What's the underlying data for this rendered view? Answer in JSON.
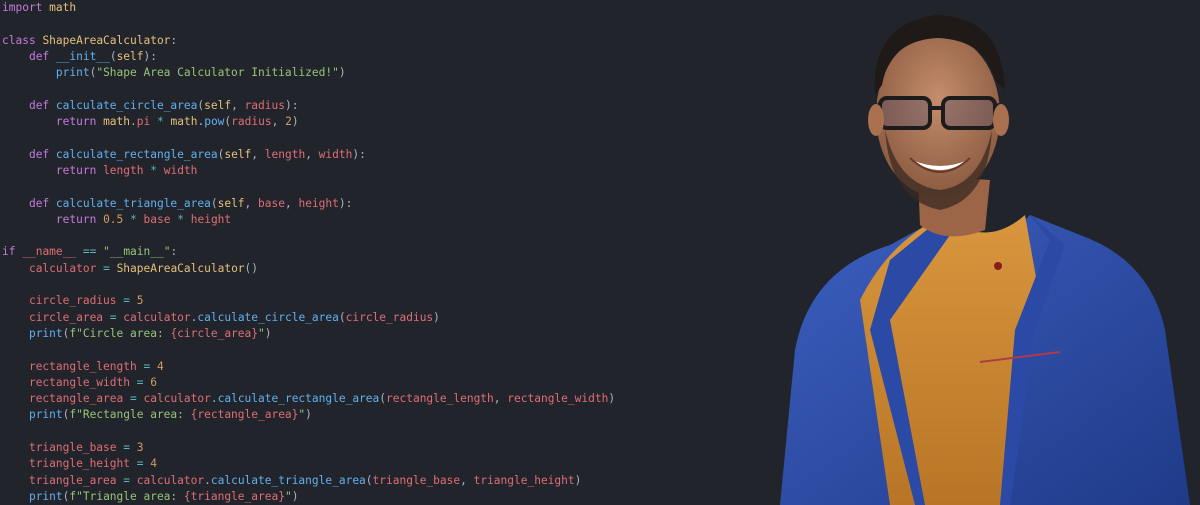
{
  "code": {
    "language": "python",
    "lines": [
      [
        {
          "t": "import",
          "c": "k"
        },
        {
          "t": " "
        },
        {
          "t": "math",
          "c": "c"
        }
      ],
      [],
      [
        {
          "t": "class",
          "c": "k"
        },
        {
          "t": " "
        },
        {
          "t": "ShapeAreaCalculator",
          "c": "c"
        },
        {
          "t": ":",
          "c": "p"
        }
      ],
      [
        {
          "t": "    "
        },
        {
          "t": "def",
          "c": "k"
        },
        {
          "t": " "
        },
        {
          "t": "__init__",
          "c": "f"
        },
        {
          "t": "(",
          "c": "p"
        },
        {
          "t": "self",
          "c": "c"
        },
        {
          "t": "):",
          "c": "p"
        }
      ],
      [
        {
          "t": "        "
        },
        {
          "t": "print",
          "c": "f"
        },
        {
          "t": "(",
          "c": "p"
        },
        {
          "t": "\"Shape Area Calculator Initialized!\"",
          "c": "s"
        },
        {
          "t": ")",
          "c": "p"
        }
      ],
      [],
      [
        {
          "t": "    "
        },
        {
          "t": "def",
          "c": "k"
        },
        {
          "t": " "
        },
        {
          "t": "calculate_circle_area",
          "c": "f"
        },
        {
          "t": "(",
          "c": "p"
        },
        {
          "t": "self",
          "c": "c"
        },
        {
          "t": ", ",
          "c": "p"
        },
        {
          "t": "radius",
          "c": "v"
        },
        {
          "t": "):",
          "c": "p"
        }
      ],
      [
        {
          "t": "        "
        },
        {
          "t": "return",
          "c": "k"
        },
        {
          "t": " "
        },
        {
          "t": "math",
          "c": "c"
        },
        {
          "t": ".",
          "c": "p"
        },
        {
          "t": "pi",
          "c": "v"
        },
        {
          "t": " "
        },
        {
          "t": "*",
          "c": "o"
        },
        {
          "t": " "
        },
        {
          "t": "math",
          "c": "c"
        },
        {
          "t": ".",
          "c": "p"
        },
        {
          "t": "pow",
          "c": "f"
        },
        {
          "t": "(",
          "c": "p"
        },
        {
          "t": "radius",
          "c": "v"
        },
        {
          "t": ", ",
          "c": "p"
        },
        {
          "t": "2",
          "c": "n"
        },
        {
          "t": ")",
          "c": "p"
        }
      ],
      [],
      [
        {
          "t": "    "
        },
        {
          "t": "def",
          "c": "k"
        },
        {
          "t": " "
        },
        {
          "t": "calculate_rectangle_area",
          "c": "f"
        },
        {
          "t": "(",
          "c": "p"
        },
        {
          "t": "self",
          "c": "c"
        },
        {
          "t": ", ",
          "c": "p"
        },
        {
          "t": "length",
          "c": "v"
        },
        {
          "t": ", ",
          "c": "p"
        },
        {
          "t": "width",
          "c": "v"
        },
        {
          "t": "):",
          "c": "p"
        }
      ],
      [
        {
          "t": "        "
        },
        {
          "t": "return",
          "c": "k"
        },
        {
          "t": " "
        },
        {
          "t": "length",
          "c": "v"
        },
        {
          "t": " "
        },
        {
          "t": "*",
          "c": "o"
        },
        {
          "t": " "
        },
        {
          "t": "width",
          "c": "v"
        }
      ],
      [],
      [
        {
          "t": "    "
        },
        {
          "t": "def",
          "c": "k"
        },
        {
          "t": " "
        },
        {
          "t": "calculate_triangle_area",
          "c": "f"
        },
        {
          "t": "(",
          "c": "p"
        },
        {
          "t": "self",
          "c": "c"
        },
        {
          "t": ", ",
          "c": "p"
        },
        {
          "t": "base",
          "c": "v"
        },
        {
          "t": ", ",
          "c": "p"
        },
        {
          "t": "height",
          "c": "v"
        },
        {
          "t": "):",
          "c": "p"
        }
      ],
      [
        {
          "t": "        "
        },
        {
          "t": "return",
          "c": "k"
        },
        {
          "t": " "
        },
        {
          "t": "0.5",
          "c": "n"
        },
        {
          "t": " "
        },
        {
          "t": "*",
          "c": "o"
        },
        {
          "t": " "
        },
        {
          "t": "base",
          "c": "v"
        },
        {
          "t": " "
        },
        {
          "t": "*",
          "c": "o"
        },
        {
          "t": " "
        },
        {
          "t": "height",
          "c": "v"
        }
      ],
      [],
      [
        {
          "t": "if",
          "c": "k"
        },
        {
          "t": " "
        },
        {
          "t": "__name__",
          "c": "v"
        },
        {
          "t": " "
        },
        {
          "t": "==",
          "c": "o"
        },
        {
          "t": " "
        },
        {
          "t": "\"__main__\"",
          "c": "s"
        },
        {
          "t": ":",
          "c": "p"
        }
      ],
      [
        {
          "t": "    "
        },
        {
          "t": "calculator",
          "c": "v"
        },
        {
          "t": " "
        },
        {
          "t": "=",
          "c": "o"
        },
        {
          "t": " "
        },
        {
          "t": "ShapeAreaCalculator",
          "c": "c"
        },
        {
          "t": "()",
          "c": "p"
        }
      ],
      [],
      [
        {
          "t": "    "
        },
        {
          "t": "circle_radius",
          "c": "v"
        },
        {
          "t": " "
        },
        {
          "t": "=",
          "c": "o"
        },
        {
          "t": " "
        },
        {
          "t": "5",
          "c": "n"
        }
      ],
      [
        {
          "t": "    "
        },
        {
          "t": "circle_area",
          "c": "v"
        },
        {
          "t": " "
        },
        {
          "t": "=",
          "c": "o"
        },
        {
          "t": " "
        },
        {
          "t": "calculator",
          "c": "v"
        },
        {
          "t": ".",
          "c": "p"
        },
        {
          "t": "calculate_circle_area",
          "c": "f"
        },
        {
          "t": "(",
          "c": "p"
        },
        {
          "t": "circle_radius",
          "c": "v"
        },
        {
          "t": ")",
          "c": "p"
        }
      ],
      [
        {
          "t": "    "
        },
        {
          "t": "print",
          "c": "f"
        },
        {
          "t": "(",
          "c": "p"
        },
        {
          "t": "f\"Circle area: ",
          "c": "s"
        },
        {
          "t": "{circle_area}",
          "c": "v"
        },
        {
          "t": "\"",
          "c": "s"
        },
        {
          "t": ")",
          "c": "p"
        }
      ],
      [],
      [
        {
          "t": "    "
        },
        {
          "t": "rectangle_length",
          "c": "v"
        },
        {
          "t": " "
        },
        {
          "t": "=",
          "c": "o"
        },
        {
          "t": " "
        },
        {
          "t": "4",
          "c": "n"
        }
      ],
      [
        {
          "t": "    "
        },
        {
          "t": "rectangle_width",
          "c": "v"
        },
        {
          "t": " "
        },
        {
          "t": "=",
          "c": "o"
        },
        {
          "t": " "
        },
        {
          "t": "6",
          "c": "n"
        }
      ],
      [
        {
          "t": "    "
        },
        {
          "t": "rectangle_area",
          "c": "v"
        },
        {
          "t": " "
        },
        {
          "t": "=",
          "c": "o"
        },
        {
          "t": " "
        },
        {
          "t": "calculator",
          "c": "v"
        },
        {
          "t": ".",
          "c": "p"
        },
        {
          "t": "calculate_rectangle_area",
          "c": "f"
        },
        {
          "t": "(",
          "c": "p"
        },
        {
          "t": "rectangle_length",
          "c": "v"
        },
        {
          "t": ", ",
          "c": "p"
        },
        {
          "t": "rectangle_width",
          "c": "v"
        },
        {
          "t": ")",
          "c": "p"
        }
      ],
      [
        {
          "t": "    "
        },
        {
          "t": "print",
          "c": "f"
        },
        {
          "t": "(",
          "c": "p"
        },
        {
          "t": "f\"Rectangle area: ",
          "c": "s"
        },
        {
          "t": "{rectangle_area}",
          "c": "v"
        },
        {
          "t": "\"",
          "c": "s"
        },
        {
          "t": ")",
          "c": "p"
        }
      ],
      [],
      [
        {
          "t": "    "
        },
        {
          "t": "triangle_base",
          "c": "v"
        },
        {
          "t": " "
        },
        {
          "t": "=",
          "c": "o"
        },
        {
          "t": " "
        },
        {
          "t": "3",
          "c": "n"
        }
      ],
      [
        {
          "t": "    "
        },
        {
          "t": "triangle_height",
          "c": "v"
        },
        {
          "t": " "
        },
        {
          "t": "=",
          "c": "o"
        },
        {
          "t": " "
        },
        {
          "t": "4",
          "c": "n"
        }
      ],
      [
        {
          "t": "    "
        },
        {
          "t": "triangle_area",
          "c": "v"
        },
        {
          "t": " "
        },
        {
          "t": "=",
          "c": "o"
        },
        {
          "t": " "
        },
        {
          "t": "calculator",
          "c": "v"
        },
        {
          "t": ".",
          "c": "p"
        },
        {
          "t": "calculate_triangle_area",
          "c": "f"
        },
        {
          "t": "(",
          "c": "p"
        },
        {
          "t": "triangle_base",
          "c": "v"
        },
        {
          "t": ", ",
          "c": "p"
        },
        {
          "t": "triangle_height",
          "c": "v"
        },
        {
          "t": ")",
          "c": "p"
        }
      ],
      [
        {
          "t": "    "
        },
        {
          "t": "print",
          "c": "f"
        },
        {
          "t": "(",
          "c": "p"
        },
        {
          "t": "f\"Triangle area: ",
          "c": "s"
        },
        {
          "t": "{triangle_area}",
          "c": "v"
        },
        {
          "t": "\"",
          "c": "s"
        },
        {
          "t": ")",
          "c": "p"
        }
      ]
    ]
  },
  "theme": {
    "background": "#21252b",
    "keyword": "#c678dd",
    "function": "#61afef",
    "class": "#e5c07b",
    "string": "#98c379",
    "variable": "#e06c75",
    "number": "#d19a66",
    "operator": "#56b6c2",
    "punctuation": "#abb2bf"
  },
  "portrait": {
    "subject": "person-portrait",
    "jacket_color": "#2d4fa8",
    "sweater_color": "#c98a35"
  }
}
